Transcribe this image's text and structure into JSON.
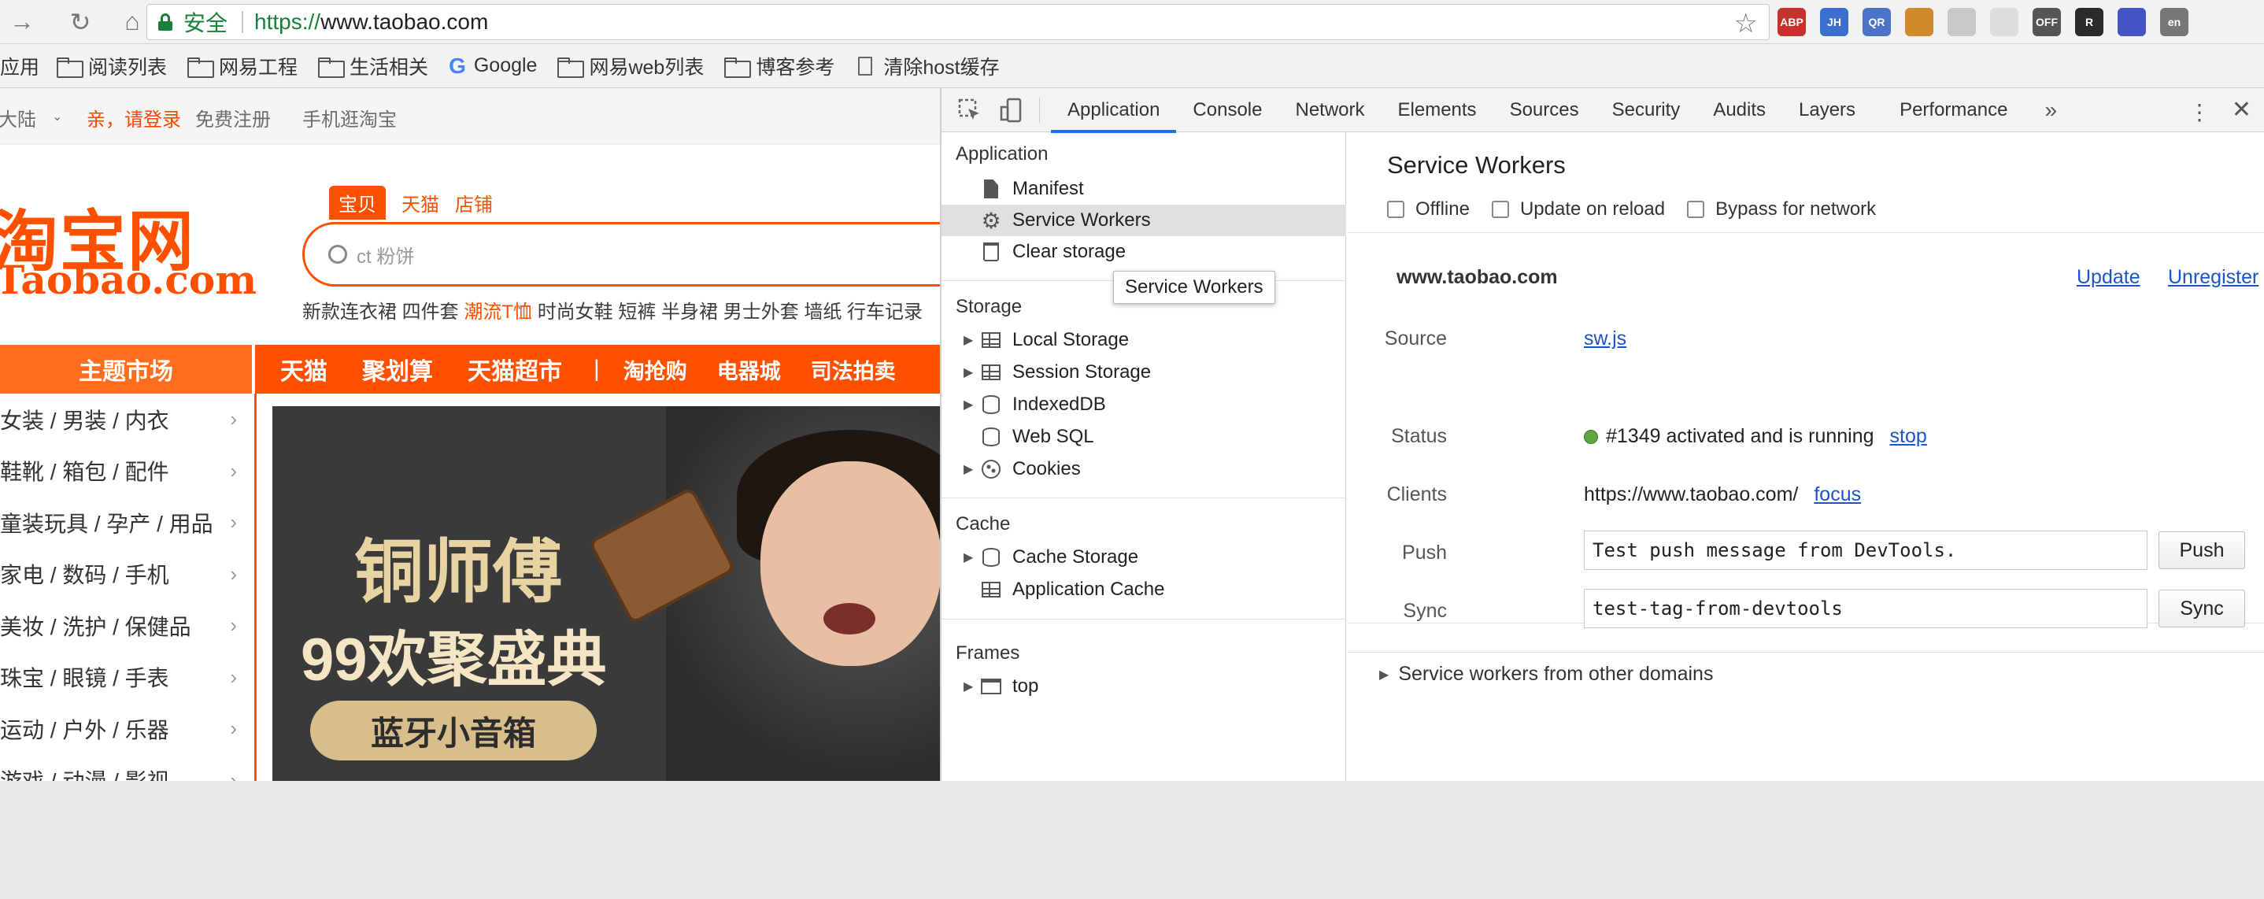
{
  "browser": {
    "security_label": "安全",
    "url_scheme": "https://",
    "url_host": "www.taobao.com",
    "extensions": [
      {
        "label": "ABP",
        "color": "#c8312b"
      },
      {
        "label": "JH",
        "color": "#3a6fcf"
      },
      {
        "label": "QR",
        "color": "#4b74c9"
      },
      {
        "label": "",
        "color": "#d08b28"
      },
      {
        "label": "",
        "color": "#c9c9c9"
      },
      {
        "label": "",
        "color": "#dddddd"
      },
      {
        "label": "OFF",
        "color": "#555555"
      },
      {
        "label": "R",
        "color": "#2a2a2a"
      },
      {
        "label": "",
        "color": "#4353c8"
      },
      {
        "label": "en",
        "color": "#777777"
      }
    ]
  },
  "bookmarks": {
    "apps": "应用",
    "items": [
      "阅读列表",
      "网易工程",
      "生活相关",
      "Google",
      "网易web列表",
      "博客参考",
      "清除host缓存"
    ]
  },
  "taobao": {
    "region": "大陆",
    "login": "亲，请登录",
    "register": "免费注册",
    "mobile": "手机逛淘宝",
    "logo_cn": "淘宝网",
    "logo_en": "Taobao.com",
    "tabs": [
      "宝贝",
      "天猫",
      "店铺"
    ],
    "search_placeholder": "ct 粉饼",
    "hot_words": [
      "新款连衣裙",
      "四件套",
      "潮流T恤",
      "时尚女鞋",
      "短裤",
      "半身裙",
      "男士外套",
      "墙纸",
      "行车记录"
    ],
    "nav_main": "主题市场",
    "nav_items": [
      "天猫",
      "聚划算",
      "天猫超市",
      "|",
      "淘抢购",
      "电器城",
      "司法拍卖"
    ],
    "categories": [
      "女装 / 男装 / 内衣",
      "鞋靴 / 箱包 / 配件",
      "童装玩具 / 孕产 / 用品",
      "家电 / 数码 / 手机",
      "美妆 / 洗护 / 保健品",
      "珠宝 / 眼镜 / 手表",
      "运动 / 户外 / 乐器",
      "游戏 / 动漫 / 影视"
    ],
    "banner_line1": "铜师傅",
    "banner_line2": "99欢聚盛典",
    "banner_cta": "蓝牙小音箱"
  },
  "devtools": {
    "tabs": [
      "Application",
      "Console",
      "Network",
      "Elements",
      "Sources",
      "Security",
      "Audits",
      "Layers",
      "Performance"
    ],
    "active_tab": "Application",
    "more": "»",
    "sidebar": {
      "application_title": "Application",
      "application_items": [
        "Manifest",
        "Service Workers",
        "Clear storage"
      ],
      "storage_title": "Storage",
      "storage_items": [
        "Local Storage",
        "Session Storage",
        "IndexedDB",
        "Web SQL",
        "Cookies"
      ],
      "cache_title": "Cache",
      "cache_items": [
        "Cache Storage",
        "Application Cache"
      ],
      "frames_title": "Frames",
      "frames_items": [
        "top"
      ]
    },
    "tooltip": "Service Workers",
    "panel": {
      "title": "Service Workers",
      "options": [
        "Offline",
        "Update on reload",
        "Bypass for network"
      ],
      "origin": "www.taobao.com",
      "update": "Update",
      "unregister": "Unregister",
      "source_label": "Source",
      "source_value": "sw.js",
      "status_label": "Status",
      "status_value": "#1349 activated and is running",
      "status_action": "stop",
      "status_color": "#5da540",
      "clients_label": "Clients",
      "clients_value": "https://www.taobao.com/",
      "clients_action": "focus",
      "push_label": "Push",
      "push_value": "Test push message from DevTools.",
      "push_button": "Push",
      "sync_label": "Sync",
      "sync_value": "test-tag-from-devtools",
      "sync_button": "Sync",
      "other_domains": "Service workers from other domains"
    }
  }
}
